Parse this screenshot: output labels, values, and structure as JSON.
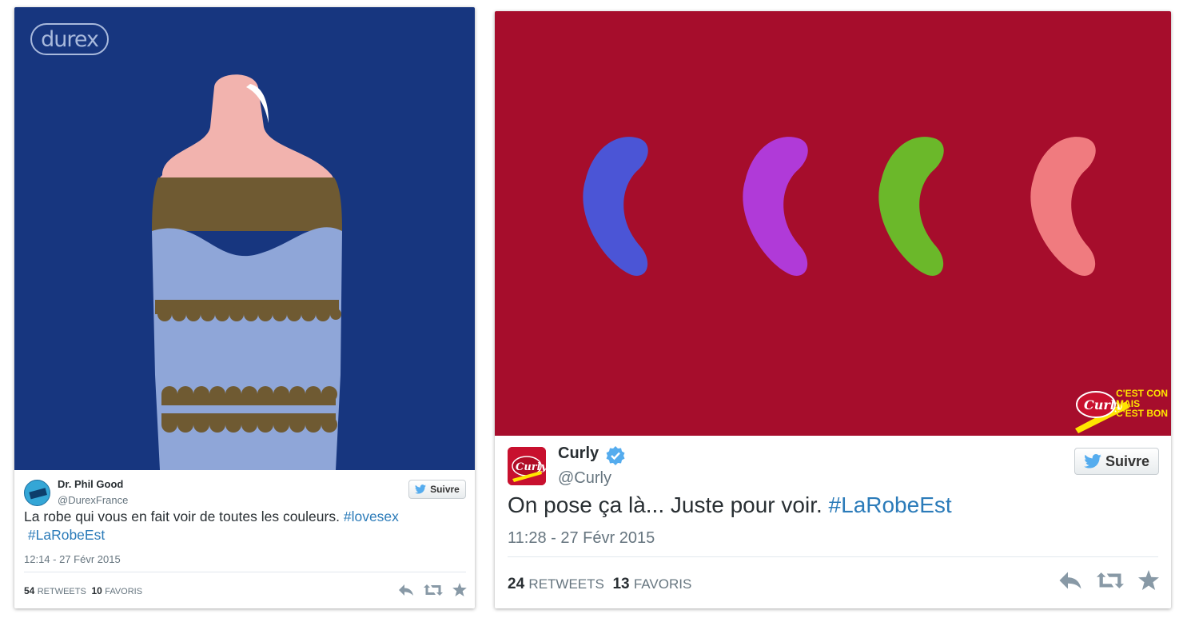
{
  "tweets": [
    {
      "media_logo": "durex",
      "name": "Dr. Phil Good",
      "handle": "@DurexFrance",
      "follow_label": "Suivre",
      "text_plain": "La robe qui vous en fait voir de toutes les couleurs.",
      "hashtag1": "#lovesex",
      "hashtag2": "#LaRobeEst",
      "timestamp": "12:14 - 27 Févr 2015",
      "retweets_count": "54",
      "retweets_label": "RETWEETS",
      "favorites_count": "10",
      "favorites_label": "FAVORIS",
      "image_colors": {
        "background": "#17367f",
        "tip": "#f2b3ae",
        "brown": "#6f5a32",
        "blue": "#8fa6d8"
      }
    },
    {
      "name": "Curly",
      "handle": "@Curly",
      "follow_label": "Suivre",
      "text_plain": "On pose ça là... Juste pour voir.",
      "hashtag1": "#LaRobeEst",
      "timestamp": "11:28 - 27 Févr 2015",
      "retweets_count": "24",
      "retweets_label": "RETWEETS",
      "favorites_count": "13",
      "favorites_label": "FAVORIS",
      "brand_tagline_1": "C'EST CON",
      "brand_tagline_2": "MAIS",
      "brand_tagline_3": "C'EST BON",
      "image_colors": {
        "background": "#a60d2c",
        "snacks": [
          "#4b55d6",
          "#b03ad8",
          "#6bb82a",
          "#f07b7f"
        ]
      }
    }
  ],
  "icons": [
    "twitter-bird-icon",
    "verified-badge-icon",
    "reply-icon",
    "retweet-icon",
    "favorite-star-icon"
  ],
  "accent": {
    "link": "#2b7bb9",
    "verified": "#55acee",
    "twitter": "#55acee"
  }
}
